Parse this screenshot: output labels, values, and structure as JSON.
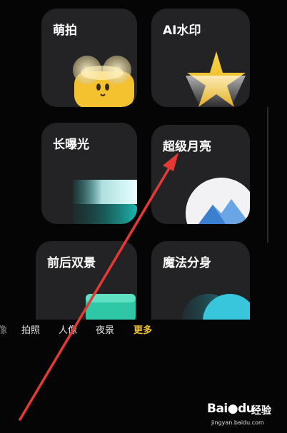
{
  "modes": {
    "cute": {
      "label": "萌拍",
      "icon": "cute-face-icon"
    },
    "watermark": {
      "label": "AI水印",
      "icon": "star-spotlight-icon"
    },
    "long_exposure": {
      "label": "长曝光",
      "icon": "long-exposure-icon"
    },
    "super_moon": {
      "label": "超级月亮",
      "icon": "moon-mountain-icon"
    },
    "dual_view": {
      "label": "前后双景",
      "icon": "dual-view-icon"
    },
    "clone": {
      "label": "魔法分身",
      "icon": "clone-icon"
    }
  },
  "mode_bar": {
    "partial": "像",
    "photo": "拍照",
    "portrait": "人像",
    "night": "夜景",
    "more": "更多"
  },
  "colors": {
    "active_mode": "#f5c431",
    "card_bg": "#232325",
    "annotation_arrow": "#e53935"
  },
  "watermark": {
    "logo": "Bai",
    "logo_tail": "du",
    "suffix": "经验",
    "url": "jingyan.baidu.com"
  }
}
